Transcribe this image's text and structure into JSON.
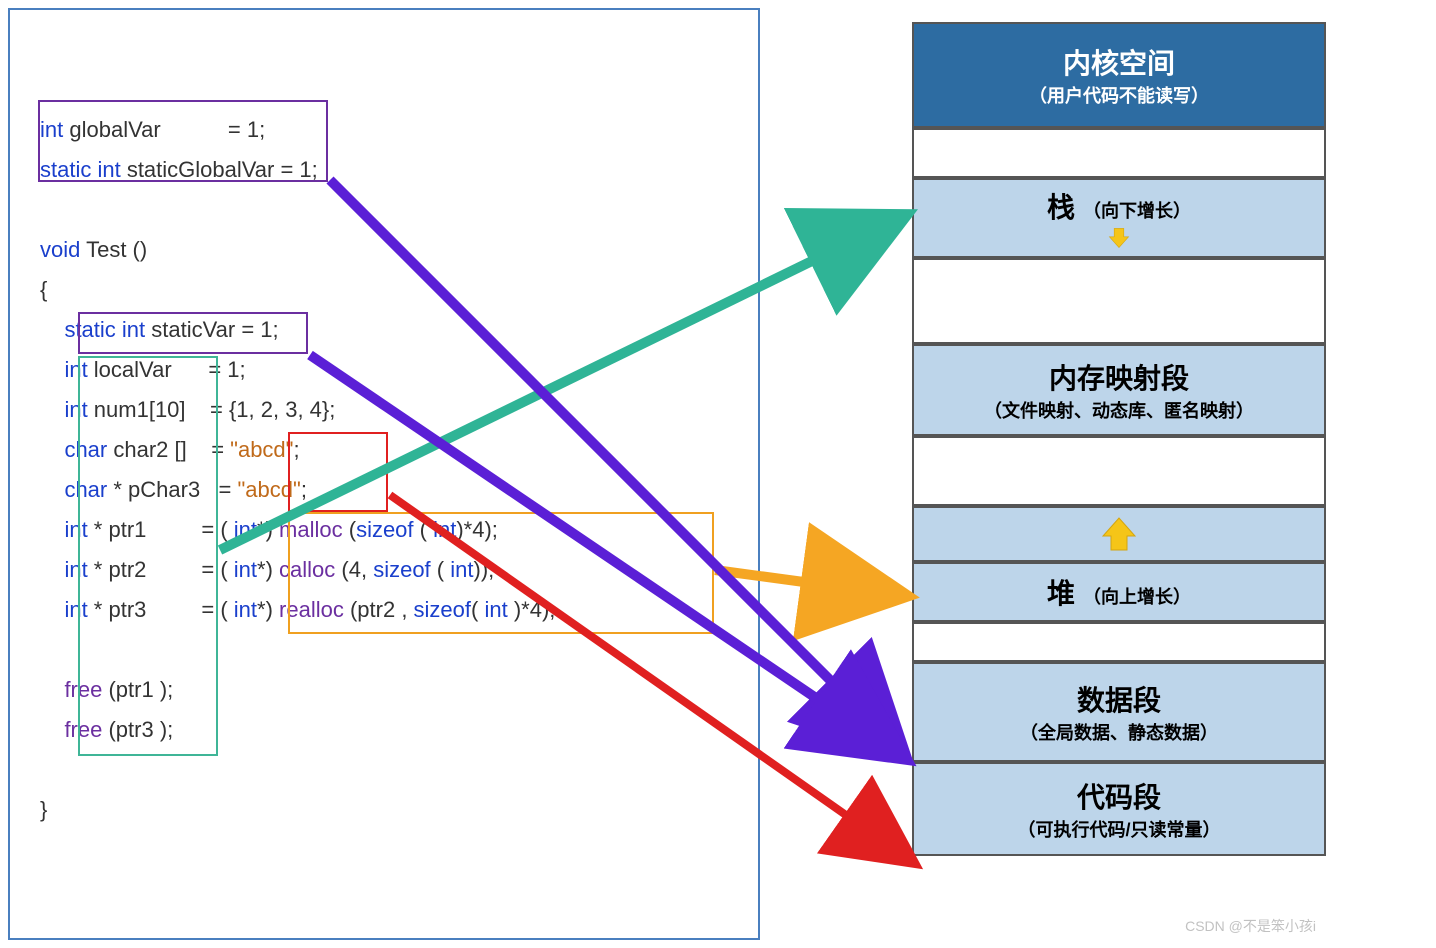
{
  "memory": {
    "kernel_title": "内核空间",
    "kernel_sub": "（用户代码不能读写）",
    "stack_title": "栈",
    "stack_sub": "（向下增长）",
    "mmap_title": "内存映射段",
    "mmap_sub": "（文件映射、动态库、匿名映射）",
    "heap_title": "堆",
    "heap_sub": "（向上增长）",
    "data_title": "数据段",
    "data_sub": "（全局数据、静态数据）",
    "code_title": "代码段",
    "code_sub": "（可执行代码/只读常量）"
  },
  "code": {
    "l1_kw": "int ",
    "l1_var": "globalVar          ",
    "l1_eq": " = 1;",
    "l2_kw": "static int ",
    "l2_var": "staticGlobalVar",
    "l2_eq": " = 1;",
    "l3_kw": "void ",
    "l3_var": "Test ()",
    "l4": "{",
    "l5_kw": "    static int ",
    "l5_var": "staticVar",
    "l5_eq": " = 1;",
    "l6_kw": "    int ",
    "l6_var": "localVar     ",
    "l6_eq": " = 1;",
    "l7_kw": "    int ",
    "l7_var": "num1[10]   ",
    "l7_eq": " = {1, 2, 3, 4};",
    "l8_kw": "    char ",
    "l8_var": "char2 []   ",
    "l8_eq": " = ",
    "l8_str": "\"abcd\"",
    "l8_end": ";",
    "l9_kw": "    char ",
    "l9_var": "* pChar3  ",
    "l9_eq": " = ",
    "l9_str": "\"abcd\"",
    "l9_end": ";",
    "l10_kw": "    int ",
    "l10_var": "* ptr1        ",
    "l10_eq": " = ( ",
    "l10_cast": "int",
    "l10_eq2": "*) ",
    "l10_fn": "malloc ",
    "l10_p1": "(",
    "l10_so": "sizeof ",
    "l10_p2": "( ",
    "l10_t": "int",
    "l10_end": ")*4);",
    "l11_kw": "    int ",
    "l11_var": "* ptr2        ",
    "l11_eq": " = ( ",
    "l11_cast": "int",
    "l11_eq2": "*) ",
    "l11_fn": "calloc ",
    "l11_p": "(4, ",
    "l11_so": "sizeof ",
    "l11_p2": "( ",
    "l11_t": "int",
    "l11_end": "));",
    "l12_kw": "    int ",
    "l12_var": "* ptr3        ",
    "l12_eq": " = ( ",
    "l12_cast": "int",
    "l12_eq2": "*) ",
    "l12_fn": "realloc ",
    "l12_p": "(ptr2 , ",
    "l12_so": "sizeof",
    "l12_p2": "( ",
    "l12_t": "int ",
    "l12_end": ")*4);",
    "l13_fn": "    free ",
    "l13_p": "(ptr1 );",
    "l14_fn": "    free ",
    "l14_p": "(ptr3 );",
    "l15": "}"
  },
  "watermark": "CSDN @不是笨小孩i",
  "colors": {
    "arrow_green": "#2fb496",
    "arrow_orange": "#f5a623",
    "arrow_purple": "#5b1fd6",
    "arrow_red": "#e02020",
    "arrow_yellow": "#f5c518"
  }
}
